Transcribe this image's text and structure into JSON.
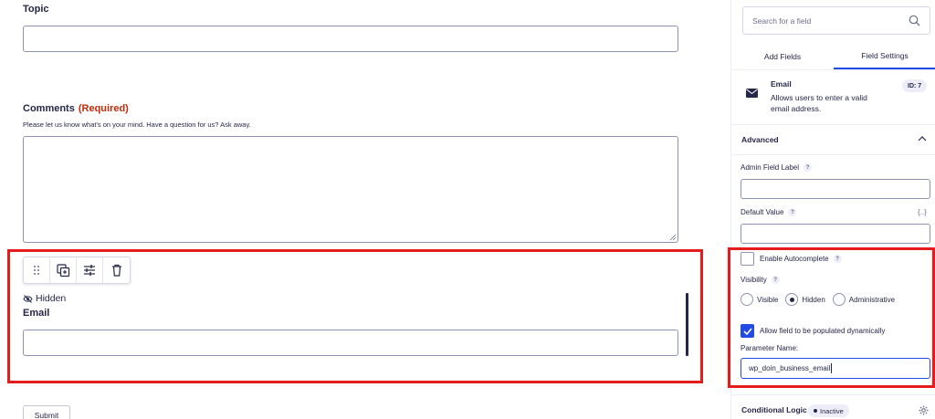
{
  "form": {
    "topic_label": "Topic",
    "comments_label": "Comments",
    "comments_required": "(Required)",
    "comments_description": "Please let us know what's on your mind. Have a question for us? Ask away.",
    "hidden_tag": "Hidden",
    "email_label": "Email",
    "submit_label": "Submit"
  },
  "toolbar": {
    "icons": [
      "drag-handle-icon",
      "duplicate-icon",
      "settings-sliders-icon",
      "trash-icon"
    ]
  },
  "sidebar": {
    "search_placeholder": "Search for a field",
    "tabs": [
      {
        "label": "Add Fields",
        "active": false
      },
      {
        "label": "Field Settings",
        "active": true
      }
    ],
    "field": {
      "title": "Email",
      "description": "Allows users to enter a valid email address.",
      "id_badge": "ID: 7"
    },
    "advanced": {
      "title": "Advanced",
      "admin_label": "Admin Field Label",
      "default_value_label": "Default Value",
      "merge_tag_icon": "{..}",
      "autocomplete_label": "Enable Autocomplete",
      "autocomplete_checked": false,
      "visibility_label": "Visibility",
      "visibility_options": [
        {
          "label": "Visible",
          "selected": false
        },
        {
          "label": "Hidden",
          "selected": true
        },
        {
          "label": "Administrative",
          "selected": false
        }
      ],
      "dynamic_label": "Allow field to be populated dynamically",
      "dynamic_checked": true,
      "param_label": "Parameter Name:",
      "param_value": "wp_doin_business_email"
    },
    "conditional": {
      "title": "Conditional Logic",
      "status": "Inactive"
    }
  },
  "colors": {
    "accent": "#204ce5",
    "highlight": "#e51c1c",
    "required": "#c02b0a",
    "text": "#242748"
  }
}
